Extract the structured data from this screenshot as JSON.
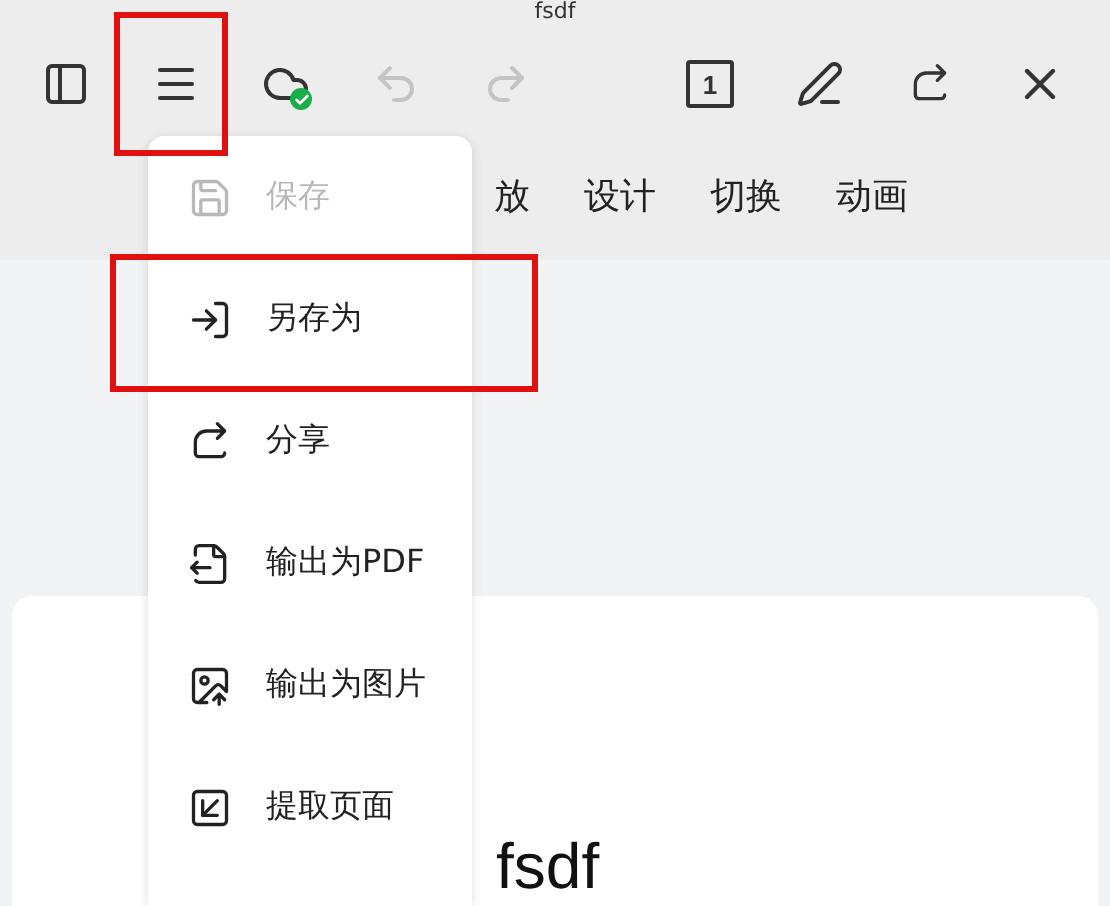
{
  "title": "fsdf",
  "toolbar": {
    "cloud_synced": true,
    "undo_disabled": true,
    "redo_disabled": true,
    "page_number": "1"
  },
  "tabs": [
    {
      "label": "放"
    },
    {
      "label": "设计"
    },
    {
      "label": "切换"
    },
    {
      "label": "动画"
    }
  ],
  "menu": {
    "items": [
      {
        "kind": "save",
        "label": "保存",
        "disabled": true
      },
      {
        "kind": "save_as",
        "label": "另存为",
        "disabled": false
      },
      {
        "kind": "share",
        "label": "分享",
        "disabled": false
      },
      {
        "kind": "pdf",
        "label": "输出为PDF",
        "disabled": false
      },
      {
        "kind": "image",
        "label": "输出为图片",
        "disabled": false
      },
      {
        "kind": "extract",
        "label": "提取页面",
        "disabled": false
      }
    ]
  },
  "document": {
    "text": "fsdf"
  }
}
